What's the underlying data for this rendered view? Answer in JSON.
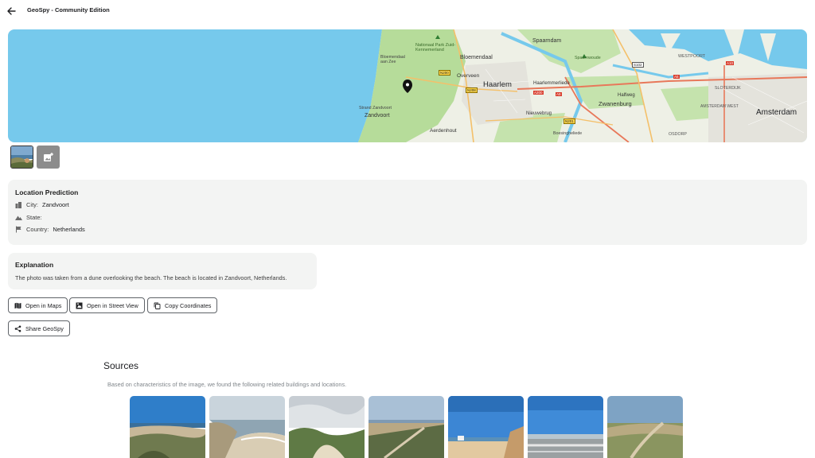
{
  "header": {
    "title": "GeoSpy - Community Edition"
  },
  "map": {
    "labels": {
      "np": "Nationaal Park Zuid-Kennemerland",
      "bloemendaal_zee": "Bloemendaal aan Zee",
      "bloemendaal": "Bloemendaal",
      "spaarndam": "Spaarndam",
      "spaarnwoude": "Spaarnwoude",
      "westpoort": "WESTPOORT",
      "overveen": "Overveen",
      "haarlem": "Haarlem",
      "haarlemmerliede": "Haarlemmerliede",
      "halfweg": "Halfweg",
      "zwanenburg": "Zwanenburg",
      "sloterdijk": "SLOTERDIJK",
      "strand": "Strand Zandvoort",
      "zandvoort": "Zandvoort",
      "nieuwebrug": "Nieuwebrug",
      "amsterdam": "Amsterdam",
      "aerdenhout": "Aerdenhout",
      "boesingheliede": "Boesingheliede",
      "osdorp": "OSDORP",
      "amsterdam_west": "AMSTERDAM WEST"
    },
    "roads": {
      "n200": "N200",
      "n208": "N208",
      "a9": "A9",
      "a200": "A200",
      "n201": "N201",
      "s102": "S102",
      "a10": "A10",
      "a5": "A5"
    }
  },
  "thumbnails": {
    "add_icon": "add-photo-icon"
  },
  "prediction": {
    "title": "Location Prediction",
    "city_label": "City:",
    "city_value": "Zandvoort",
    "state_label": "State:",
    "state_value": "",
    "country_label": "Country:",
    "country_value": "Netherlands"
  },
  "explanation": {
    "title": "Explanation",
    "text": "The photo was taken from a dune overlooking the beach. The beach is located in Zandvoort, Netherlands."
  },
  "actions": {
    "open_maps": "Open in Maps",
    "street_view": "Open in Street View",
    "copy_coords": "Copy Coordinates",
    "share": "Share GeoSpy"
  },
  "sources": {
    "title": "Sources",
    "subtitle": "Based on characteristics of the image, we found the following related buildings and locations."
  },
  "colors": {
    "water": "#76c9ec",
    "land": "#eef0e6",
    "green": "#b6dc9a",
    "card_bg": "#f3f4f3"
  }
}
